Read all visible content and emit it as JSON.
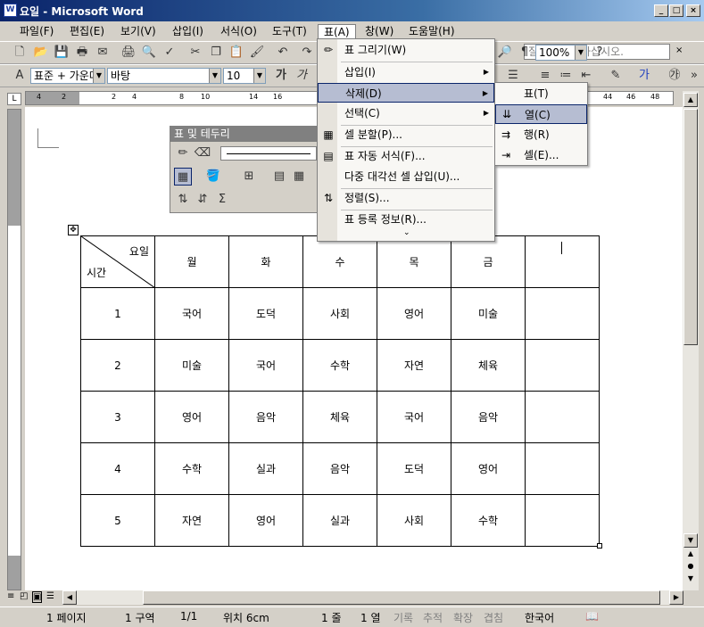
{
  "window": {
    "title": "요일 - Microsoft Word",
    "app_icon_label": "W"
  },
  "menubar": {
    "items": [
      {
        "label": "파일(F)"
      },
      {
        "label": "편집(E)"
      },
      {
        "label": "보기(V)"
      },
      {
        "label": "삽입(I)"
      },
      {
        "label": "서식(O)"
      },
      {
        "label": "도구(T)"
      },
      {
        "label": "표(A)"
      },
      {
        "label": "창(W)"
      },
      {
        "label": "도움말(H)"
      }
    ],
    "help_placeholder": "질문을 입력하십시오."
  },
  "toolbar": {
    "zoom": "100%",
    "style": "표준 + 가운데",
    "font": "바탕",
    "font_size": "10"
  },
  "ruler": {
    "labels": [
      "4",
      "2",
      "2",
      "4",
      "8",
      "10",
      "14",
      "16",
      "44",
      "46",
      "48"
    ]
  },
  "table_menu": {
    "items": [
      {
        "label": "표 그리기(W)"
      },
      {
        "label": "삽입(I)"
      },
      {
        "label": "삭제(D)"
      },
      {
        "label": "선택(C)"
      },
      {
        "label": "셀 분할(P)..."
      },
      {
        "label": "표 자동 서식(F)..."
      },
      {
        "label": "다중 대각선 셀 삽입(U)..."
      },
      {
        "label": "정렬(S)..."
      },
      {
        "label": "표 등록 정보(R)..."
      }
    ]
  },
  "delete_submenu": {
    "items": [
      {
        "label": "표(T)"
      },
      {
        "label": "열(C)"
      },
      {
        "label": "행(R)"
      },
      {
        "label": "셀(E)..."
      }
    ]
  },
  "tables_borders_toolbar": {
    "title": "표 및 테두리"
  },
  "timetable": {
    "corner_top": "요일",
    "corner_bottom": "시간",
    "days": [
      "월",
      "화",
      "수",
      "목",
      "금",
      ""
    ],
    "rows": [
      {
        "period": "1",
        "cells": [
          "국어",
          "도덕",
          "사회",
          "영어",
          "미술",
          ""
        ]
      },
      {
        "period": "2",
        "cells": [
          "미술",
          "국어",
          "수학",
          "자연",
          "체육",
          ""
        ]
      },
      {
        "period": "3",
        "cells": [
          "영어",
          "음악",
          "체육",
          "국어",
          "음악",
          ""
        ]
      },
      {
        "period": "4",
        "cells": [
          "수학",
          "실과",
          "음악",
          "도덕",
          "영어",
          ""
        ]
      },
      {
        "period": "5",
        "cells": [
          "자연",
          "영어",
          "실과",
          "사회",
          "수학",
          ""
        ]
      }
    ]
  },
  "statusbar": {
    "page": "1 페이지",
    "section": "1 구역",
    "page_of": "1/1",
    "position": "위치 6cm",
    "line": "1 줄",
    "column": "1 열",
    "rec": "기록",
    "trk": "추적",
    "ext": "확장",
    "ovr": "겹침",
    "language": "한국어"
  }
}
